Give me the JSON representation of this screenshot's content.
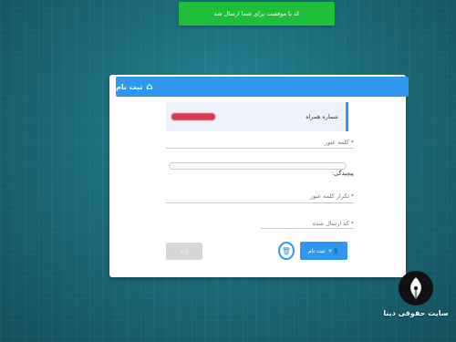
{
  "toast": {
    "message": "کد با موفقیت برای شما ارسال شد"
  },
  "card": {
    "title": "ثبت نام",
    "header_icon": "home-icon"
  },
  "form": {
    "phone_label": "شماره همراه",
    "password_label": "کلمه عبور",
    "captcha_label": "پیچیدگی:",
    "confirm_password_label": "تکرار کلمه عبور",
    "code_label": "کد ارسال شده",
    "required_mark": "*"
  },
  "buttons": {
    "register_label": "ثبت نام",
    "disabled_label": "ثانیه"
  },
  "logo": {
    "text": "سایت حقوقی دینا"
  },
  "colors": {
    "accent": "#2f98ee",
    "toast": "#1fbf3a",
    "required": "#e53935",
    "redacted": "#d7263d"
  }
}
